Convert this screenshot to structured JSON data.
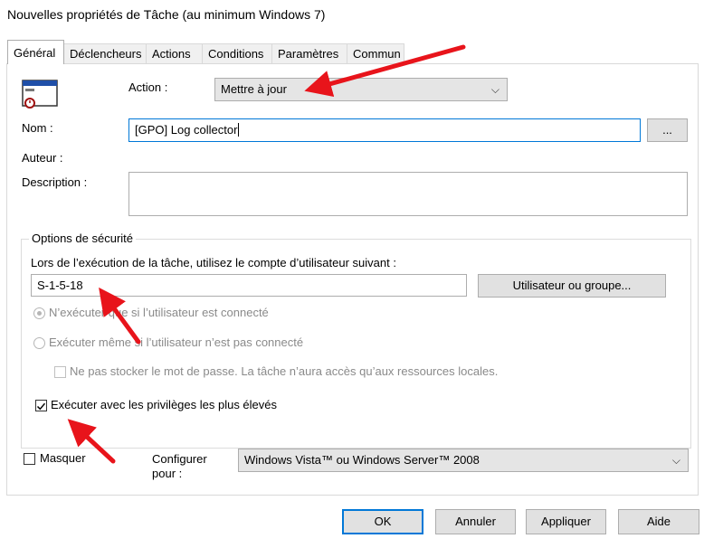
{
  "window": {
    "title": "Nouvelles propriétés de Tâche (au minimum Windows 7)"
  },
  "tabs": [
    {
      "label": "Général",
      "active": true
    },
    {
      "label": "Déclencheurs"
    },
    {
      "label": "Actions"
    },
    {
      "label": "Conditions"
    },
    {
      "label": "Paramètres"
    },
    {
      "label": "Commun"
    }
  ],
  "general": {
    "action_label": "Action :",
    "action_value": "Mettre à jour",
    "name_label": "Nom :",
    "name_value": "[GPO] Log collector",
    "browse_label": "...",
    "author_label": "Auteur :",
    "description_label": "Description :",
    "description_value": ""
  },
  "security": {
    "group_title": "Options de sécurité",
    "run_as_label": "Lors de l’exécution de la tâche, utilisez le compte d’utilisateur suivant :",
    "account_value": "S-1-5-18",
    "user_group_button": "Utilisateur ou groupe...",
    "radio_logged_on": "N’exécuter que si l’utilisateur est connecté",
    "radio_whether_logged": "Exécuter même si l’utilisateur n’est pas connecté",
    "no_store_password": "Ne pas stocker le mot de passe. La tâche n’aura accès qu’aux ressources locales.",
    "highest_privileges": "Exécuter avec les privilèges les plus élevés",
    "highest_privileges_checked": true
  },
  "footer": {
    "hidden_label": "Masquer",
    "configure_label_line1": "Configurer",
    "configure_label_line2": "pour :",
    "configure_value": "Windows Vista™ ou Windows Server™ 2008"
  },
  "buttons": {
    "ok": "OK",
    "cancel": "Annuler",
    "apply": "Appliquer",
    "help": "Aide"
  },
  "colors": {
    "annotation_arrow": "#e8141b",
    "focus_border": "#0078d7"
  }
}
